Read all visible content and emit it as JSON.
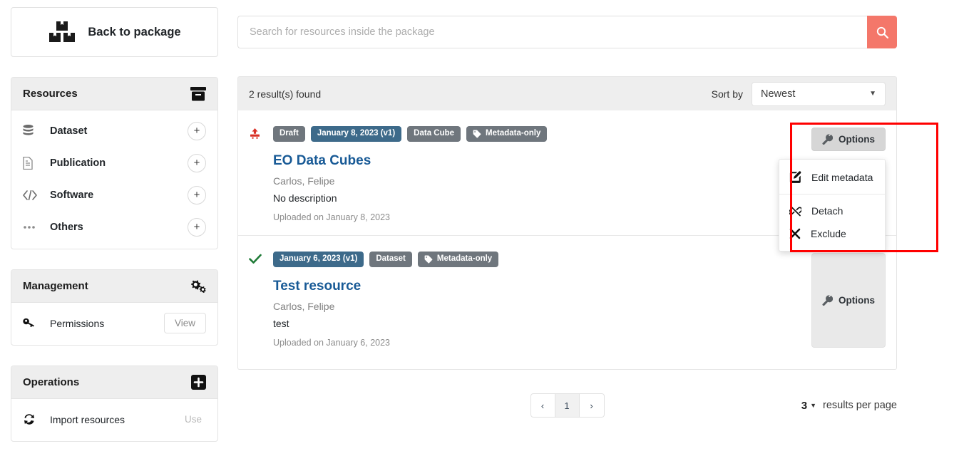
{
  "back_button": {
    "label": "Back to package",
    "icon": "boxes-icon"
  },
  "sidebar": {
    "panels": [
      {
        "title": "Resources",
        "header_icon": "archive-icon",
        "items": [
          {
            "label": "Dataset",
            "icon": "database-icon",
            "action": "+"
          },
          {
            "label": "Publication",
            "icon": "file-alt-icon",
            "action": "+"
          },
          {
            "label": "Software",
            "icon": "code-icon",
            "action": "+"
          },
          {
            "label": "Others",
            "icon": "ellipsis-icon",
            "action": "+"
          }
        ]
      },
      {
        "title": "Management",
        "header_icon": "cogs-icon",
        "items": [
          {
            "label": "Permissions",
            "icon": "key-icon",
            "action": "View"
          }
        ]
      },
      {
        "title": "Operations",
        "header_icon": "plus-square-icon",
        "items": [
          {
            "label": "Import resources",
            "icon": "sync-icon",
            "action": "Use"
          }
        ]
      }
    ]
  },
  "search": {
    "placeholder": "Search for resources inside the package",
    "value": "",
    "button_icon": "search-icon",
    "button_color": "#f4776a"
  },
  "results_header": {
    "count_text": "2 result(s) found",
    "sort_label": "Sort by",
    "sort_value": "Newest",
    "sort_options": [
      "Newest"
    ]
  },
  "results": [
    {
      "status_icon": "upload-icon",
      "status_color": "#d93025",
      "badges": [
        {
          "text": "Draft",
          "style": "gray",
          "icon": null
        },
        {
          "text": "January 8, 2023 (v1)",
          "style": "blue",
          "icon": null
        },
        {
          "text": "Data Cube",
          "style": "gray",
          "icon": null
        },
        {
          "text": "Metadata-only",
          "style": "gray",
          "icon": "tag-icon"
        }
      ],
      "title": "EO Data Cubes",
      "authors": "Carlos, Felipe",
      "description": "No description",
      "uploaded": "Uploaded on January 8, 2023",
      "options_label": "Options",
      "options_open": true
    },
    {
      "status_icon": "check-icon",
      "status_color": "#1e7a36",
      "badges": [
        {
          "text": "January 6, 2023 (v1)",
          "style": "blue",
          "icon": null
        },
        {
          "text": "Dataset",
          "style": "gray",
          "icon": null
        },
        {
          "text": "Metadata-only",
          "style": "gray",
          "icon": "tag-icon"
        }
      ],
      "title": "Test resource",
      "authors": "Carlos, Felipe",
      "description": "test",
      "uploaded": "Uploaded on January 6, 2023",
      "options_label": "Options",
      "options_open": false
    }
  ],
  "options_menu": {
    "items": [
      {
        "label": "Edit metadata",
        "icon": "pen-square-icon"
      },
      {
        "label": "Detach",
        "icon": "unlink-icon"
      },
      {
        "label": "Exclude",
        "icon": "times-icon"
      }
    ],
    "highlight_color": "#ff0000"
  },
  "pagination": {
    "prev": "‹",
    "next": "›",
    "pages": [
      "1"
    ],
    "current_page": "1",
    "per_page_value": "3",
    "per_page_label": "results per page"
  }
}
